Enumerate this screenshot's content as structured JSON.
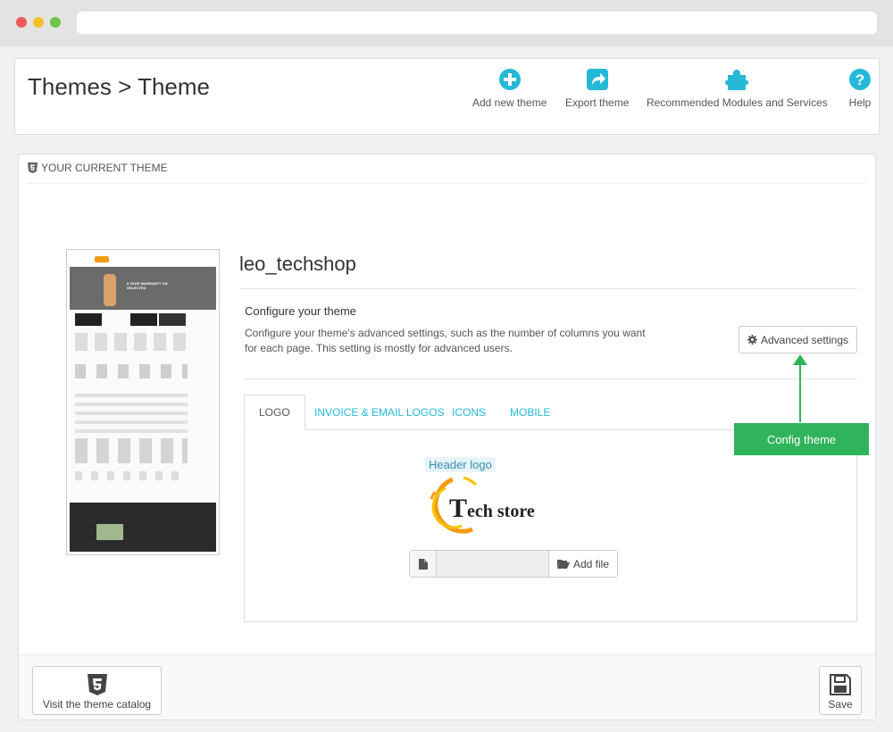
{
  "header": {
    "title": "Themes > Theme",
    "toolbar": [
      {
        "label": "Add new theme",
        "icon": "plus-circle-icon"
      },
      {
        "label": "Export theme",
        "icon": "share-icon"
      },
      {
        "label": "Recommended Modules and Services",
        "icon": "puzzle-icon"
      },
      {
        "label": "Help",
        "icon": "help-icon"
      }
    ]
  },
  "panel": {
    "heading": "YOUR CURRENT THEME",
    "theme_name": "leo_techshop",
    "configure": {
      "title": "Configure your theme",
      "description": "Configure your theme's advanced settings, such as the number of columns you want for each page. This setting is mostly for advanced users.",
      "button_label": "Advanced settings"
    },
    "tabs": [
      "LOGO",
      "INVOICE & EMAIL LOGOS",
      "ICONS",
      "MOBILE"
    ],
    "active_tab": "LOGO",
    "logo": {
      "label": "Header logo",
      "text_big": "T",
      "text_rest": "ech store",
      "add_file_label": "Add file"
    }
  },
  "annotation": {
    "label": "Config theme"
  },
  "footer": {
    "catalog_label": "Visit the theme catalog",
    "save_label": "Save"
  },
  "colors": {
    "accent": "#25b9d7",
    "annotation_green": "#2fb35b",
    "logo_orange": "#f39c12",
    "logo_yellow": "#f5c400"
  },
  "preview": {
    "banner_text": "5 YEAR WARRANTY ON SELECTED"
  }
}
